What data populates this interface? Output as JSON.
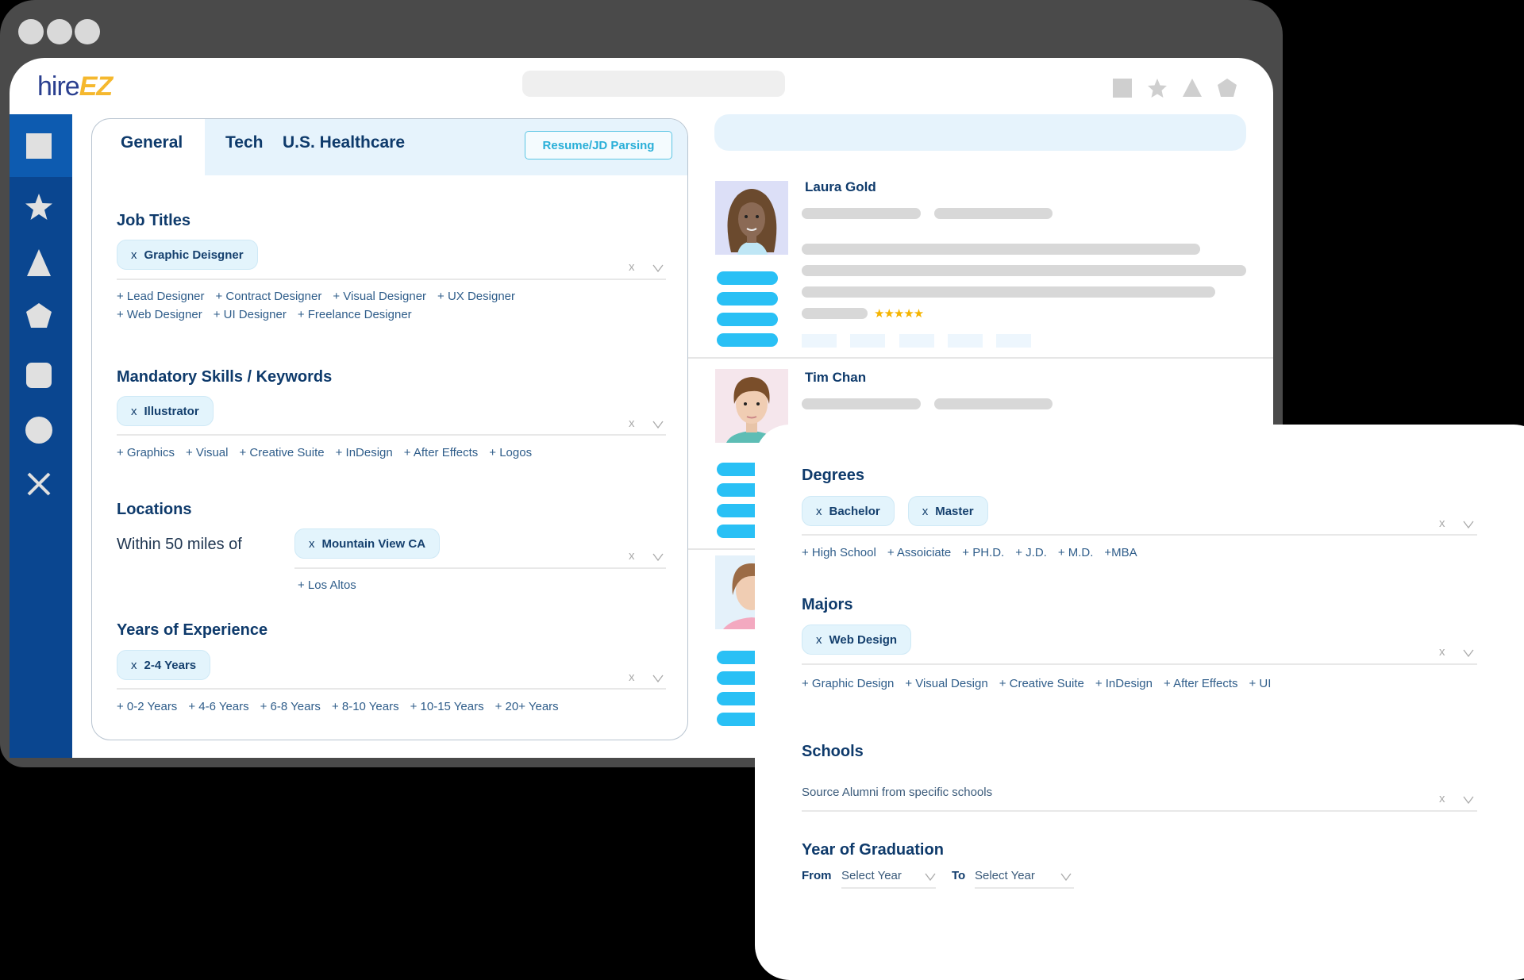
{
  "browser": {
    "logo": {
      "part1": "hire",
      "part2": "EZ"
    }
  },
  "top_icons": [
    "square-icon",
    "star-icon",
    "triangle-icon",
    "pentagon-icon"
  ],
  "sidebar": {
    "icons": [
      "square-icon",
      "star-icon",
      "triangle-icon",
      "pentagon-icon",
      "rounded-square-icon",
      "circle-icon",
      "close-icon"
    ]
  },
  "filters": {
    "tabs": [
      "General",
      "Tech",
      "U.S. Healthcare"
    ],
    "active_tab": "General",
    "parse_button": "Resume/JD Parsing",
    "job_titles": {
      "heading": "Job Titles",
      "chips": [
        "Graphic Deisgner"
      ],
      "suggestions": [
        "+ Lead Designer",
        "+ Contract Designer",
        "+ Visual Designer",
        "+ UX Designer",
        "+ Web Designer",
        "+ UI Designer",
        "+ Freelance Designer"
      ]
    },
    "skills": {
      "heading": "Mandatory Skills / Keywords",
      "chips": [
        "Illustrator"
      ],
      "suggestions": [
        "+ Graphics",
        "+ Visual",
        "+ Creative Suite",
        "+ InDesign",
        "+ After Effects",
        "+ Logos"
      ]
    },
    "locations": {
      "heading": "Locations",
      "prefix": "Within 50 miles of",
      "chips": [
        "Mountain View CA"
      ],
      "suggestions": [
        "+ Los Altos"
      ]
    },
    "experience": {
      "heading": "Years of Experience",
      "chips": [
        "2-4 Years"
      ],
      "suggestions": [
        "+ 0-2 Years",
        "+ 4-6 Years",
        "+ 6-8 Years",
        "+ 8-10 Years",
        "+ 10-15 Years",
        "+ 20+ Years"
      ]
    },
    "clear_glyph": "x",
    "chip_remove_glyph": "x"
  },
  "candidates": [
    {
      "name": "Laura Gold",
      "rating": 5,
      "stars": "★★★★★"
    },
    {
      "name": "Tim Chan"
    }
  ],
  "education": {
    "degrees": {
      "heading": "Degrees",
      "chips": [
        "Bachelor",
        "Master"
      ],
      "suggestions": [
        "+ High School",
        "+ Assoiciate",
        "+ PH.D.",
        "+ J.D.",
        "+ M.D.",
        "+MBA"
      ]
    },
    "majors": {
      "heading": "Majors",
      "chips": [
        "Web Design"
      ],
      "suggestions": [
        "+ Graphic Design",
        "+ Visual Design",
        "+ Creative Suite",
        "+ InDesign",
        "+ After Effects",
        "+ UI"
      ]
    },
    "schools": {
      "heading": "Schools",
      "placeholder": "Source Alumni from specific schools"
    },
    "graduation": {
      "heading": "Year of Graduation",
      "from_label": "From",
      "to_label": "To",
      "from_placeholder": "Select Year",
      "to_placeholder": "Select Year"
    }
  },
  "colors": {
    "sidebar": "#0a4690",
    "heading": "#0e3a6b",
    "accent": "#29c0f5",
    "logo_ez": "#f5b82e",
    "star": "#f5b400"
  }
}
